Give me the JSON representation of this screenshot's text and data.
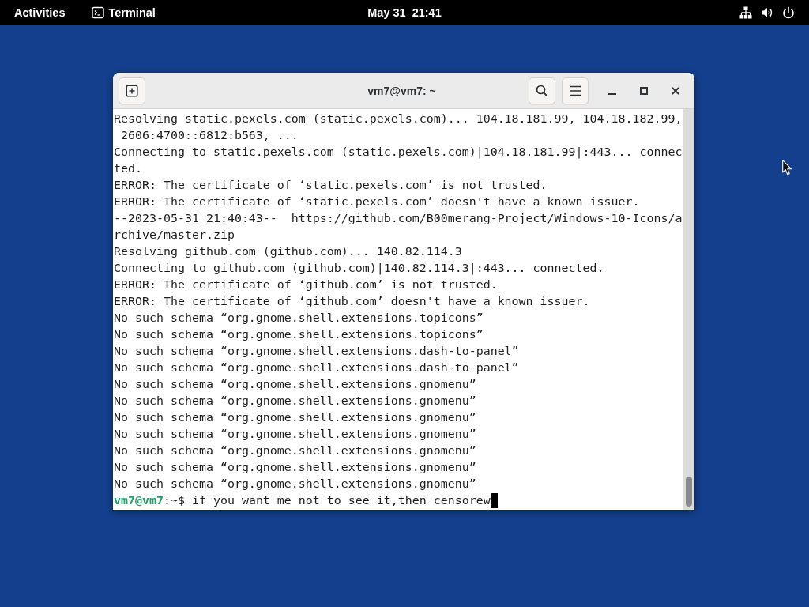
{
  "top_bar": {
    "activities": "Activities",
    "app": "Terminal",
    "clock": "May 31  21:41"
  },
  "window": {
    "title": "vm7@vm7: ~"
  },
  "terminal": {
    "lines": [
      "Resolving static.pexels.com (static.pexels.com)... 104.18.181.99, 104.18.182.99,",
      " 2606:4700::6812:b563, ...",
      "Connecting to static.pexels.com (static.pexels.com)|104.18.181.99|:443... connec",
      "ted.",
      "ERROR: The certificate of ‘static.pexels.com’ is not trusted.",
      "ERROR: The certificate of ‘static.pexels.com’ doesn't have a known issuer.",
      "--2023-05-31 21:40:43--  https://github.com/B00merang-Project/Windows-10-Icons/a",
      "rchive/master.zip",
      "Resolving github.com (github.com)... 140.82.114.3",
      "Connecting to github.com (github.com)|140.82.114.3|:443... connected.",
      "ERROR: The certificate of ‘github.com’ is not trusted.",
      "ERROR: The certificate of ‘github.com’ doesn't have a known issuer.",
      "No such schema “org.gnome.shell.extensions.topicons”",
      "No such schema “org.gnome.shell.extensions.topicons”",
      "No such schema “org.gnome.shell.extensions.dash-to-panel”",
      "No such schema “org.gnome.shell.extensions.dash-to-panel”",
      "No such schema “org.gnome.shell.extensions.gnomenu”",
      "No such schema “org.gnome.shell.extensions.gnomenu”",
      "No such schema “org.gnome.shell.extensions.gnomenu”",
      "No such schema “org.gnome.shell.extensions.gnomenu”",
      "No such schema “org.gnome.shell.extensions.gnomenu”",
      "No such schema “org.gnome.shell.extensions.gnomenu”",
      "No such schema “org.gnome.shell.extensions.gnomenu”"
    ],
    "prompt": {
      "user_host": "vm7@vm7",
      "path": ":~$"
    },
    "command": "if you want me not to see it,then censorew"
  }
}
